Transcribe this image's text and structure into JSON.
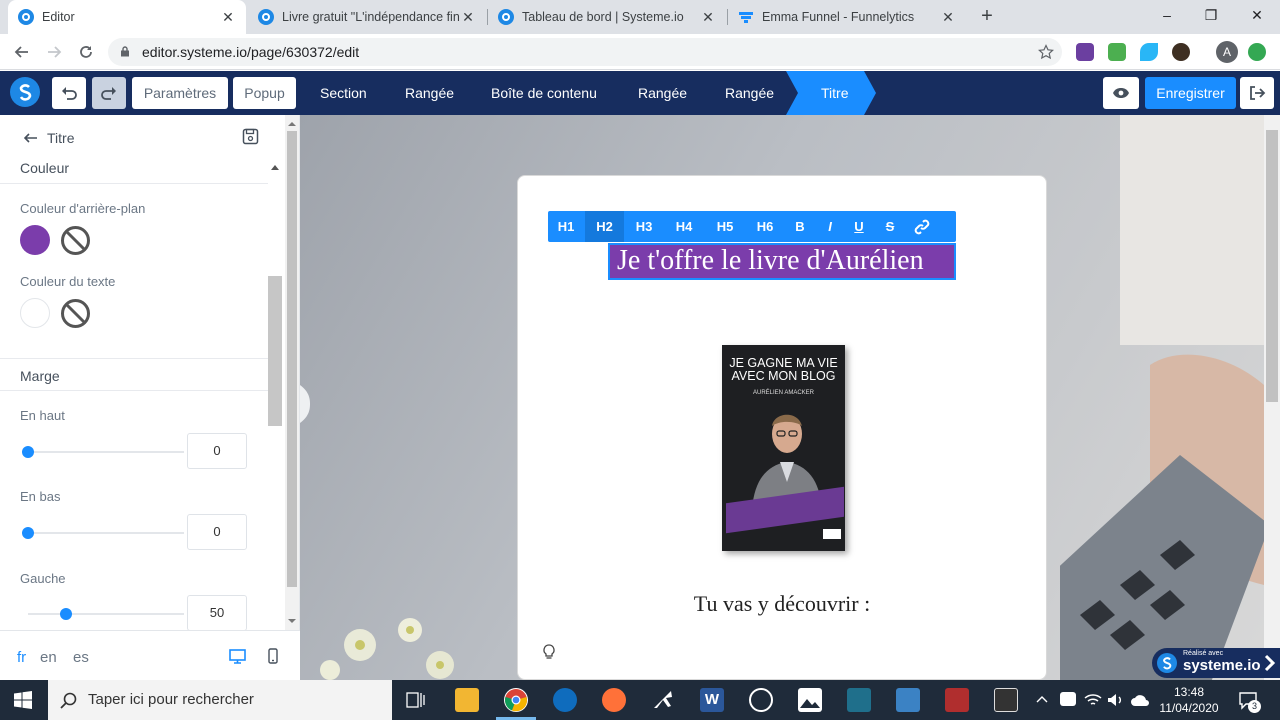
{
  "browser": {
    "tabs": [
      {
        "title": "Editor",
        "active": true
      },
      {
        "title": "Livre gratuit \"L'indépendance fin",
        "active": false
      },
      {
        "title": "Tableau de bord | Systeme.io",
        "active": false
      },
      {
        "title": "Emma Funnel - Funnelytics",
        "active": false
      }
    ],
    "url": "editor.systeme.io/page/630372/edit",
    "window_controls": {
      "minimize": "–",
      "restore": "❐",
      "close": "✕"
    }
  },
  "editor_bar": {
    "parametres_label": "Paramètres",
    "popup_label": "Popup",
    "breadcrumbs": [
      "Section",
      "Rangée",
      "Boîte de contenu",
      "Rangée",
      "Rangée",
      "Titre"
    ],
    "save_label": "Enregistrer"
  },
  "panel": {
    "back_label": "Titre",
    "section_couleur": "Couleur",
    "bg_color_label": "Couleur d'arrière-plan",
    "text_color_label": "Couleur du texte",
    "section_marge": "Marge",
    "margin_top_label": "En haut",
    "margin_top_value": "0",
    "margin_bottom_label": "En bas",
    "margin_bottom_value": "0",
    "margin_left_label": "Gauche",
    "margin_left_value": "50",
    "languages": [
      "fr",
      "en",
      "es"
    ],
    "colors": {
      "bg_swatch": "#7b3dab",
      "text_swatch": "#ffffff",
      "accent": "#1a8dff"
    }
  },
  "canvas": {
    "format_buttons": [
      "H1",
      "H2",
      "H3",
      "H4",
      "H5",
      "H6",
      "B",
      "I",
      "U",
      "S"
    ],
    "headline": "Je t'offre le livre d'Aurélien",
    "book_title": "JE GAGNE MA VIE AVEC MON BLOG",
    "book_author": "AURÉLIEN AMACKER",
    "subtitle": "Tu vas y découvrir :",
    "badge_small": "Réalisé avec",
    "badge_brand": "systeme.io"
  },
  "taskbar": {
    "search_placeholder": "Taper ici pour rechercher",
    "time": "13:48",
    "date": "11/04/2020",
    "notifications": "3"
  }
}
